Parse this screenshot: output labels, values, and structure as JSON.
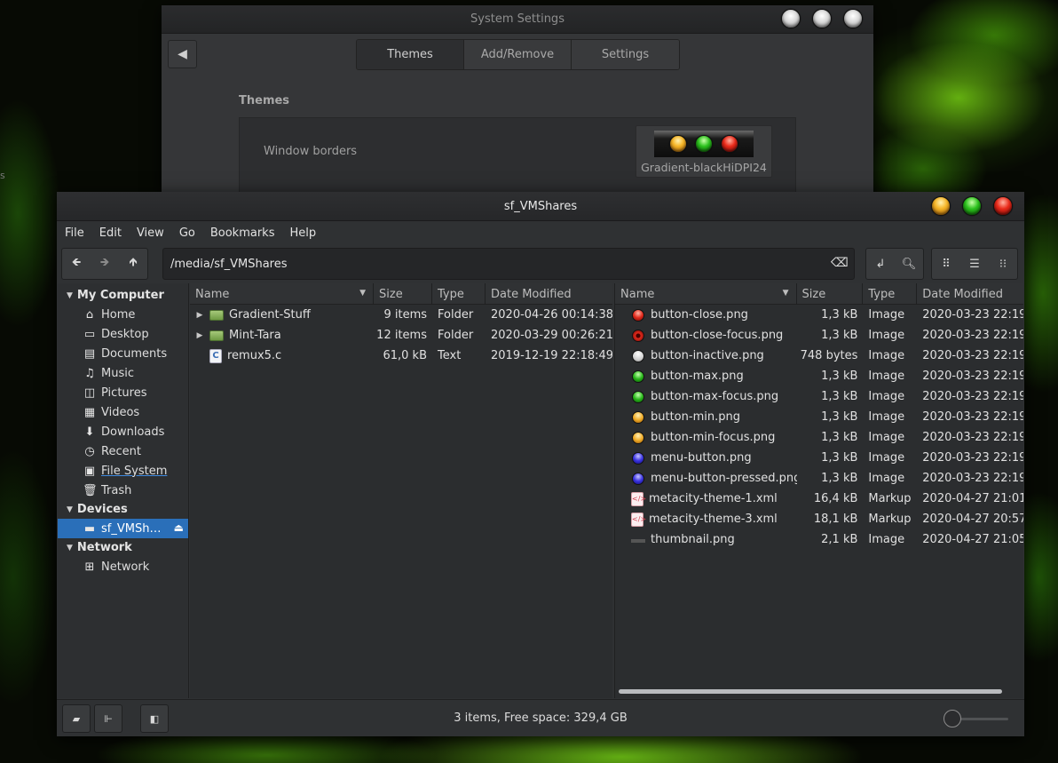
{
  "desktop": {
    "edge_text": "s"
  },
  "settings": {
    "title": "System Settings",
    "tabs": [
      "Themes",
      "Add/Remove",
      "Settings"
    ],
    "active_tab": "Themes",
    "section": "Themes",
    "row_label": "Window borders",
    "theme_name": "Gradient-blackHiDPI24"
  },
  "nemo": {
    "title": "sf_VMShares",
    "menu": [
      "File",
      "Edit",
      "View",
      "Go",
      "Bookmarks",
      "Help"
    ],
    "path": "/media/sf_VMShares",
    "sidebar": {
      "my_computer": {
        "label": "My Computer",
        "items": [
          {
            "label": "Home",
            "icon": "home-icon"
          },
          {
            "label": "Desktop",
            "icon": "desktop-icon"
          },
          {
            "label": "Documents",
            "icon": "documents-icon"
          },
          {
            "label": "Music",
            "icon": "music-icon"
          },
          {
            "label": "Pictures",
            "icon": "pictures-icon"
          },
          {
            "label": "Videos",
            "icon": "videos-icon"
          },
          {
            "label": "Downloads",
            "icon": "downloads-icon"
          },
          {
            "label": "Recent",
            "icon": "recent-icon"
          },
          {
            "label": "File System",
            "icon": "filesystem-icon"
          },
          {
            "label": "Trash",
            "icon": "trash-icon"
          }
        ]
      },
      "devices": {
        "label": "Devices",
        "items": [
          {
            "label": "sf_VMSh…",
            "icon": "drive-icon"
          }
        ]
      },
      "network": {
        "label": "Network",
        "items": [
          {
            "label": "Network",
            "icon": "network-icon"
          }
        ]
      }
    },
    "columns": {
      "name": "Name",
      "size": "Size",
      "type": "Type",
      "modified": "Date Modified"
    },
    "left_files": [
      {
        "name": "Gradient-Stuff",
        "size": "9 items",
        "type": "Folder",
        "modified": "2020-04-26 00:14:38",
        "icon": "folder"
      },
      {
        "name": "Mint-Tara",
        "size": "12 items",
        "type": "Folder",
        "modified": "2020-03-29 00:26:21",
        "icon": "folder"
      },
      {
        "name": "remux5.c",
        "size": "61,0 kB",
        "type": "Text",
        "modified": "2019-12-19 22:18:49",
        "icon": "c-file"
      }
    ],
    "right_files": [
      {
        "name": "button-close.png",
        "size": "1,3 kB",
        "type": "Image",
        "modified": "2020-03-23 22:19:",
        "icon": "red"
      },
      {
        "name": "button-close-focus.png",
        "size": "1,3 kB",
        "type": "Image",
        "modified": "2020-03-23 22:19:",
        "icon": "redx"
      },
      {
        "name": "button-inactive.png",
        "size": "748 bytes",
        "type": "Image",
        "modified": "2020-03-23 22:19:",
        "icon": "grey"
      },
      {
        "name": "button-max.png",
        "size": "1,3 kB",
        "type": "Image",
        "modified": "2020-03-23 22:19:",
        "icon": "green"
      },
      {
        "name": "button-max-focus.png",
        "size": "1,3 kB",
        "type": "Image",
        "modified": "2020-03-23 22:19:",
        "icon": "green"
      },
      {
        "name": "button-min.png",
        "size": "1,3 kB",
        "type": "Image",
        "modified": "2020-03-23 22:19:",
        "icon": "yellow"
      },
      {
        "name": "button-min-focus.png",
        "size": "1,3 kB",
        "type": "Image",
        "modified": "2020-03-23 22:19:",
        "icon": "yellow"
      },
      {
        "name": "menu-button.png",
        "size": "1,3 kB",
        "type": "Image",
        "modified": "2020-03-23 22:19:",
        "icon": "blue"
      },
      {
        "name": "menu-button-pressed.png",
        "size": "1,3 kB",
        "type": "Image",
        "modified": "2020-03-23 22:19:",
        "icon": "blue"
      },
      {
        "name": "metacity-theme-1.xml",
        "size": "16,4 kB",
        "type": "Markup",
        "modified": "2020-04-27 21:01:",
        "icon": "xml"
      },
      {
        "name": "metacity-theme-3.xml",
        "size": "18,1 kB",
        "type": "Markup",
        "modified": "2020-04-27 20:57:",
        "icon": "xml"
      },
      {
        "name": "thumbnail.png",
        "size": "2,1 kB",
        "type": "Image",
        "modified": "2020-04-27 21:05:",
        "icon": "thumb"
      }
    ],
    "status": "3 items, Free space: 329,4 GB"
  }
}
